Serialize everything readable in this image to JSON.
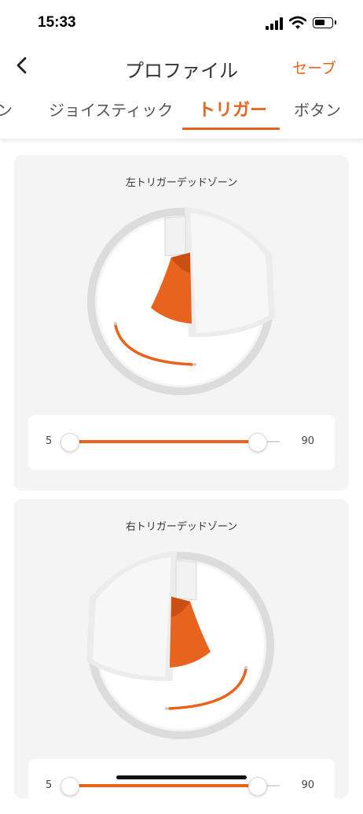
{
  "status_bar": {
    "time": "15:33"
  },
  "nav": {
    "title": "プロファイル",
    "save_label": "セーブ"
  },
  "tabs": [
    {
      "label": "ン",
      "active": false
    },
    {
      "label": "ジョイスティック",
      "active": false
    },
    {
      "label": "トリガー",
      "active": true
    },
    {
      "label": "ボタン",
      "active": false
    }
  ],
  "left_trigger": {
    "title": "左トリガーデッドゾーン",
    "slider": {
      "min_value": "5",
      "max_value": "90"
    }
  },
  "right_trigger": {
    "title": "右トリガーデッドゾーン",
    "slider": {
      "min_value": "5",
      "max_value": "90"
    }
  },
  "colors": {
    "accent": "#e8641e",
    "card_bg": "#f4f4f4",
    "ring": "#dcdcdc"
  }
}
